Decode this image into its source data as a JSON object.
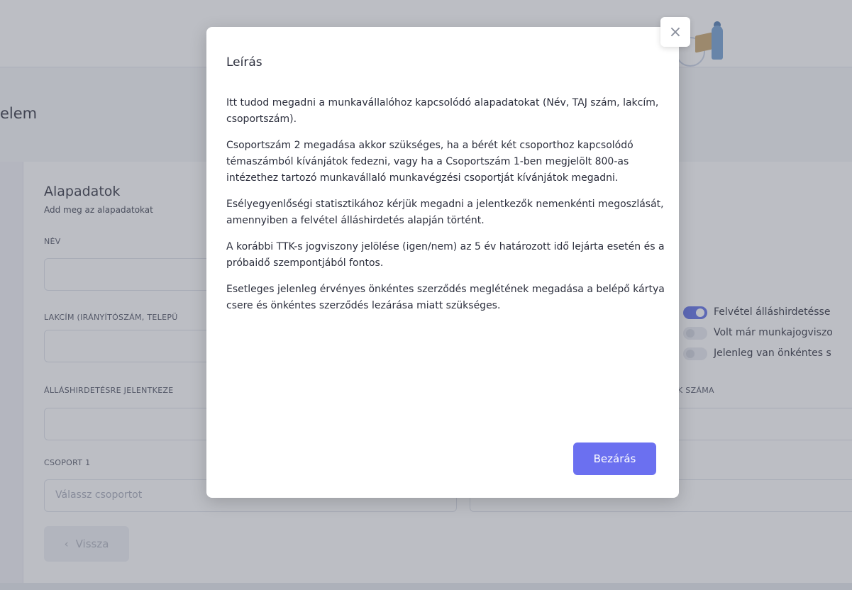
{
  "page": {
    "title": "elem",
    "section_title": "Alapadatok",
    "section_subtitle": "Add meg az alapadatokat",
    "fields": {
      "name_label": "NÉV",
      "address_label": "LAKCÍM (IRÁNYÍTÓSZÁM, TELEPÜ",
      "applicants_label": "ÁLLÁSHIRDETÉSRE JELENTKEZE",
      "applicants_count_label": "K SZÁMA",
      "group1_label": "CSOPORT 1",
      "group1_placeholder": "Válassz csoportot"
    },
    "toggles": [
      {
        "label": "Felvétel álláshirdetésse",
        "on": true
      },
      {
        "label": "Volt már munkajogviszo",
        "on": false
      },
      {
        "label": "Jelenleg van önkéntes s",
        "on": false
      }
    ],
    "back_button": "Vissza",
    "back_icon": "chevron-left-icon"
  },
  "modal": {
    "title": "Leírás",
    "paragraphs": [
      "Itt tudod megadni a munkavállalóhoz kapcsolódó alapadatokat (Név, TAJ szám, lakcím, csoportszám).",
      "Csoportszám 2 megadása akkor szükséges, ha a bérét két csoporthoz kapcsolódó témaszámból kívánjátok fedezni, vagy ha a Csoportszám 1-ben megjelölt 800-as intézethez tartozó munkavállaló munkavégzési csoportját kívánjátok megadni.",
      "Esélyegyenlőségi statisztikához kérjük megadni a jelentkezők nemenkénti megoszlását, amennyiben a felvétel álláshirdetés alapján történt.",
      "A korábbi TTK-s jogviszony jelölése (igen/nem) az 5 év határozott idő lejárta esetén és a próbaidő szempontjából fontos.",
      "Esetleges jelenleg érvényes önkéntes szerződés meglétének megadása a belépő kártya csere és önkéntes szerződés lezárása miatt szükséges."
    ],
    "close_button": "Bezárás",
    "close_icon_glyph": "×"
  },
  "colors": {
    "accent": "#6b70f0",
    "toggle_on": "#5b6be6"
  }
}
